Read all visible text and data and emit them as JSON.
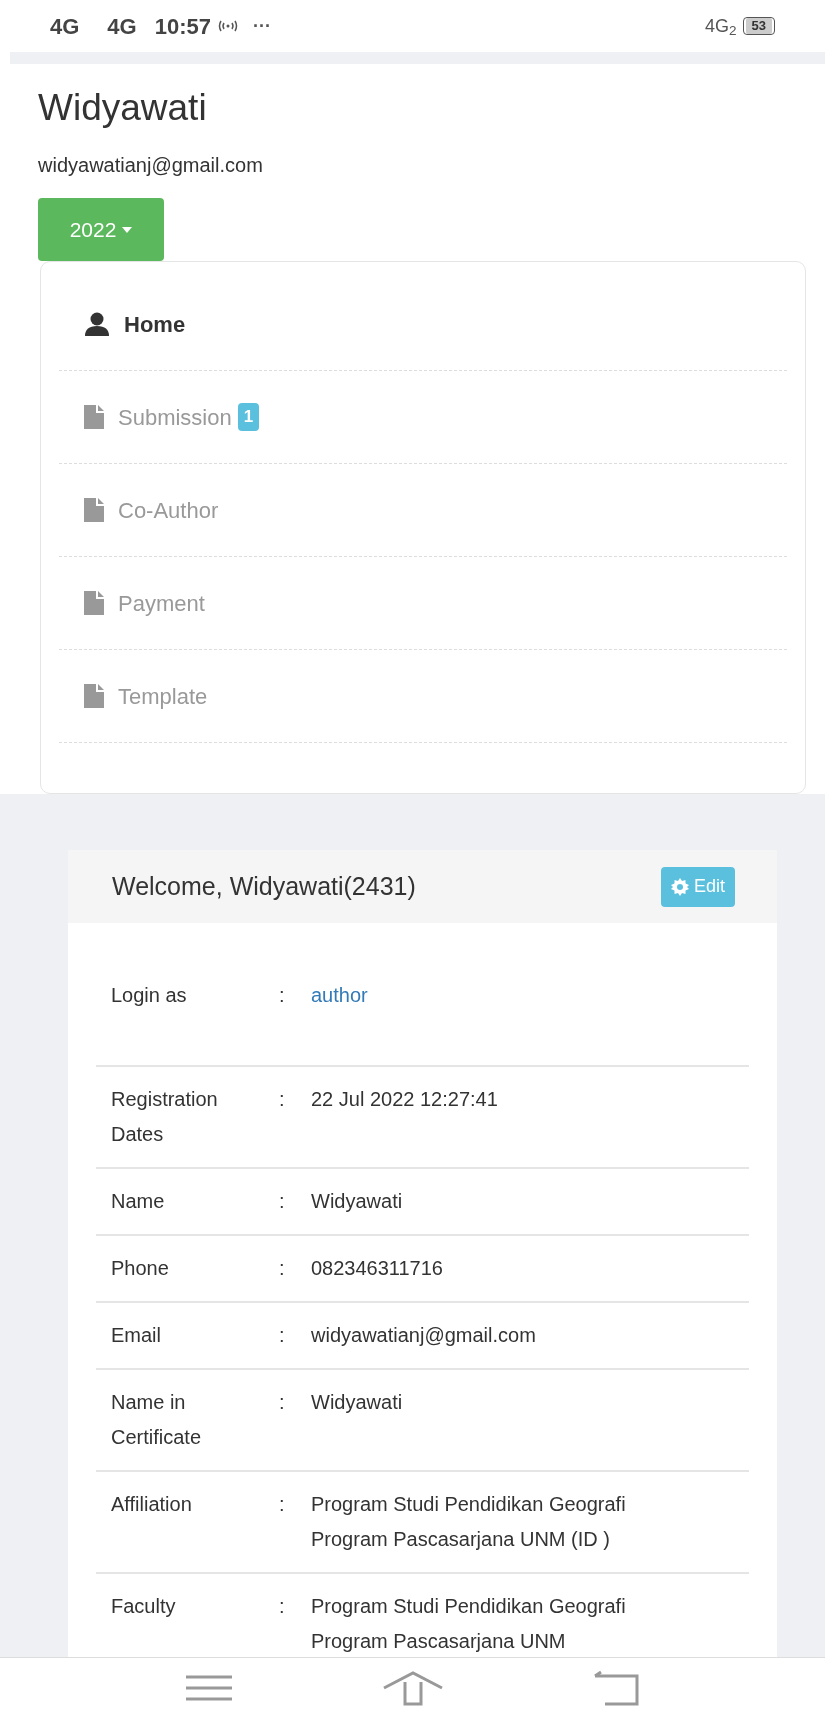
{
  "status_bar": {
    "left": [
      "4G",
      "4G"
    ],
    "time": "10:57",
    "more": "···",
    "network": "4G$_{2}$",
    "battery": "53"
  },
  "profile": {
    "name": "Widyawati",
    "email": "widyawatianj@gmail.com",
    "year_button": "2022"
  },
  "nav": [
    {
      "label": "Home",
      "kind": "user",
      "selected": true
    },
    {
      "label": "Submission",
      "kind": "file",
      "selected": false,
      "badge": "1"
    },
    {
      "label": "Co-Author",
      "kind": "file",
      "selected": false
    },
    {
      "label": "Payment",
      "kind": "file",
      "selected": false
    },
    {
      "label": "Template",
      "kind": "file",
      "selected": false
    }
  ],
  "welcome": {
    "title": "Welcome, Widyawati(2431)",
    "edit_button": "Edit",
    "rows": [
      {
        "label": "Login as",
        "separator": ":",
        "value": [
          "author"
        ],
        "kind": "link"
      },
      {
        "label": "Registration Dates",
        "separator": ":",
        "value": [
          "22 Jul 2022 12:27:41"
        ],
        "kind": "text"
      },
      {
        "label": "Name",
        "separator": ":",
        "value": [
          "Widyawati"
        ],
        "kind": "text"
      },
      {
        "label": "Phone",
        "separator": ":",
        "value": [
          "082346311716"
        ],
        "kind": "text"
      },
      {
        "label": "Email",
        "separator": ":",
        "value": [
          "widyawatianj@gmail.com"
        ],
        "kind": "text"
      },
      {
        "label": "Name in Certificate",
        "separator": ":",
        "value": [
          "Widyawati"
        ],
        "kind": "text"
      },
      {
        "label": "Affiliation",
        "separator": ":",
        "value": [
          "Program Studi Pendidikan Geografi",
          "Program Pascasarjana UNM (ID )"
        ],
        "kind": "text"
      },
      {
        "label": "Faculty",
        "separator": ":",
        "value": [
          "Program Studi Pendidikan Geografi",
          "Program Pascasarjana UNM"
        ],
        "kind": "text"
      }
    ]
  }
}
